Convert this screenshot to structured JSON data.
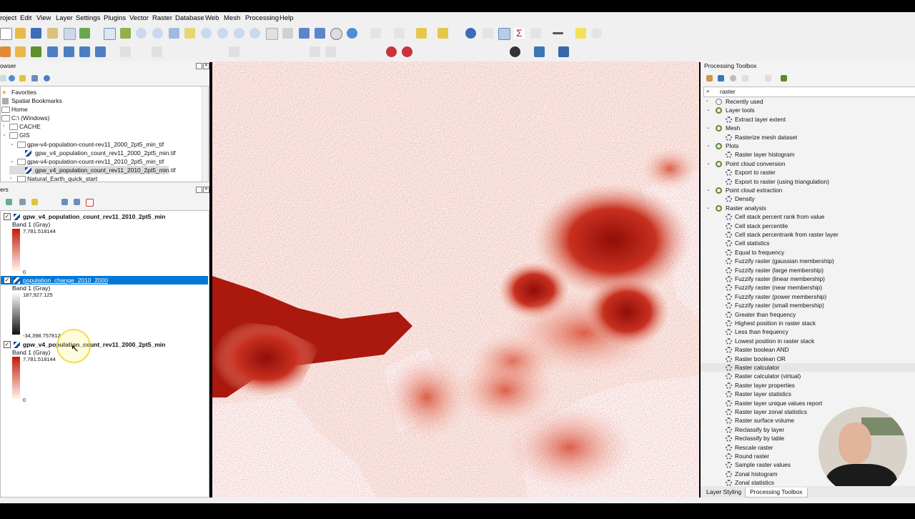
{
  "menu": {
    "project": "roject",
    "edit": "Edit",
    "view": "View",
    "layer": "Layer",
    "settings": "Settings",
    "plugins": "Plugins",
    "vector": "Vector",
    "raster": "Raster",
    "database": "Database",
    "web": "Web",
    "mesh": "Mesh",
    "processing": "Processing",
    "help": "Help"
  },
  "browser": {
    "title": "owser",
    "items": [
      "Favorites",
      "Spatial Bookmarks",
      "Home",
      "C:\\ (Windows)",
      "CACHE",
      "GIS",
      "gpw-v4-population-count-rev11_2000_2pt5_min_tif",
      "gpw_v4_population_count_rev11_2000_2pt5_min.tif",
      "gpw-v4-population-count-rev11_2010_2pt5_min_tif",
      "gpw_v4_population_count_rev11_2010_2pt5_min.tif",
      "Natural_Earth_quick_start"
    ]
  },
  "layers": {
    "title": "ers",
    "items": [
      {
        "name": "gpw_v4_population_count_rev11_2010_2pt5_min",
        "band": "Band 1 (Gray)",
        "max": "7,781.518144",
        "min": "0"
      },
      {
        "name": "population_change_2010_2000",
        "band": "Band 1 (Gray)",
        "max": "187,927.125",
        "min": "-34,398.757812"
      },
      {
        "name": "gpw_v4_population_count_rev11_2000_2pt5_min",
        "band": "Band 1 (Gray)",
        "max": "7,781.518144",
        "min": "0"
      }
    ]
  },
  "toolbox": {
    "title": "Processing Toolbox",
    "search": "raster",
    "groups": [
      {
        "label": "Recently used",
        "icon": "clock-icon",
        "items": []
      },
      {
        "label": "Layer tools",
        "icon": "qgis-icon",
        "items": [
          "Extract layer extent"
        ]
      },
      {
        "label": "Mesh",
        "icon": "qgis-icon",
        "items": [
          "Rasterize mesh dataset"
        ]
      },
      {
        "label": "Plots",
        "icon": "qgis-icon",
        "items": [
          "Raster layer histogram"
        ]
      },
      {
        "label": "Point cloud conversion",
        "icon": "qgis-icon",
        "items": [
          "Export to raster",
          "Export to raster (using triangulation)"
        ]
      },
      {
        "label": "Point cloud extraction",
        "icon": "qgis-icon",
        "items": [
          "Density"
        ]
      },
      {
        "label": "Raster analysis",
        "icon": "qgis-icon",
        "items": [
          "Cell stack percent rank from value",
          "Cell stack percentile",
          "Cell stack percentrank from raster layer",
          "Cell statistics",
          "Equal to frequency",
          "Fuzzify raster (gaussian membership)",
          "Fuzzify raster (large membership)",
          "Fuzzify raster (linear membership)",
          "Fuzzify raster (near membership)",
          "Fuzzify raster (power membership)",
          "Fuzzify raster (small membership)",
          "Greater than frequency",
          "Highest position in raster stack",
          "Less than frequency",
          "Lowest position in raster stack",
          "Raster boolean AND",
          "Raster boolean OR",
          "Raster calculator",
          "Raster calculator (virtual)",
          "Raster layer properties",
          "Raster layer statistics",
          "Raster layer unique values report",
          "Raster layer zonal statistics",
          "Raster surface volume",
          "Reclassify by layer",
          "Reclassify by table",
          "Rescale raster",
          "Round raster",
          "Sample raster values",
          "Zonal histogram",
          "Zonal statistics"
        ]
      }
    ],
    "hovered": "Raster calculator"
  },
  "tabs": {
    "layer_styling": "Layer Styling",
    "processing_toolbox": "Processing Toolbox"
  },
  "colors": {
    "accent": "#0078d7",
    "ramp_high": "#7a0000",
    "ramp_low": "#fff5f0"
  }
}
